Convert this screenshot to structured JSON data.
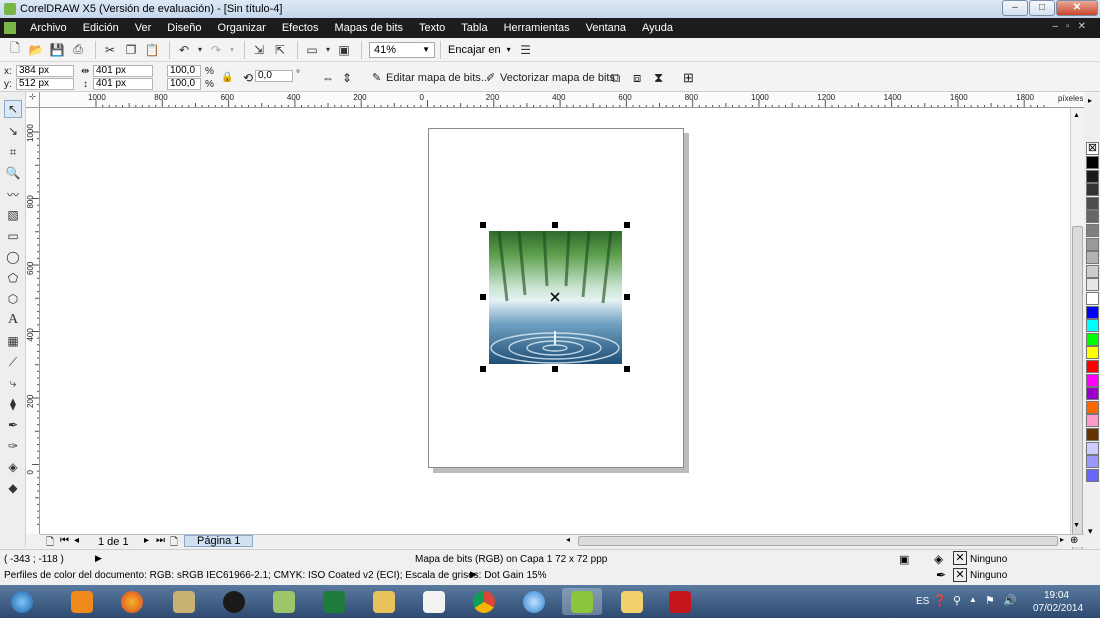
{
  "window": {
    "title": "CorelDRAW X5 (Versión de evaluación) - [Sin título-4]"
  },
  "menu": [
    "Archivo",
    "Edición",
    "Ver",
    "Diseño",
    "Organizar",
    "Efectos",
    "Mapas de bits",
    "Texto",
    "Tabla",
    "Herramientas",
    "Ventana",
    "Ayuda"
  ],
  "toolbar": {
    "zoom": "41%",
    "snap_label": "Encajar en"
  },
  "properties": {
    "x": "384 px",
    "y": "512 px",
    "width": "401 px",
    "height": "401 px",
    "scale_x": "100,0",
    "scale_y": "100,0",
    "percent": "%",
    "rotation": "0,0",
    "degree": "°",
    "edit_bitmap": "Editar mapa de bits...",
    "vectorize": "Vectorizar mapa de bits",
    "x_label": "x:",
    "y_label": "y:"
  },
  "ruler": {
    "top_ticks": [
      "1000",
      "800",
      "600",
      "400",
      "200",
      "0",
      "200",
      "400",
      "600",
      "800",
      "1000",
      "1200",
      "1400",
      "1600",
      "1800"
    ],
    "unit": "píxeles",
    "left_ticks": [
      "1000",
      "800",
      "600",
      "400",
      "200",
      "0"
    ]
  },
  "pages": {
    "counter": "1 de 1",
    "tab": "Página 1"
  },
  "status": {
    "coords": "( -343 ; -118 )",
    "selection": "Mapa de bits (RGB) on Capa 1 72 x 72 ppp",
    "fill": "Ninguno",
    "outline": "Ninguno",
    "profiles": "Perfiles de color del documento: RGB: sRGB IEC61966-2.1; CMYK: ISO Coated v2 (ECI); Escala de grises: Dot Gain 15%"
  },
  "palette_colors": [
    "#000000",
    "#1a1a1a",
    "#333333",
    "#4d4d4d",
    "#666666",
    "#808080",
    "#999999",
    "#b3b3b3",
    "#cccccc",
    "#e6e6e6",
    "#ffffff",
    "#0000ff",
    "#00ffff",
    "#00ff00",
    "#ffff00",
    "#ff0000",
    "#ff00ff",
    "#9900cc",
    "#ff6600",
    "#ff99cc",
    "#663300",
    "#ccccff",
    "#9999ff",
    "#6666ff"
  ],
  "taskbar": {
    "lang": "ES",
    "time": "19:04",
    "date": "07/02/2014"
  }
}
